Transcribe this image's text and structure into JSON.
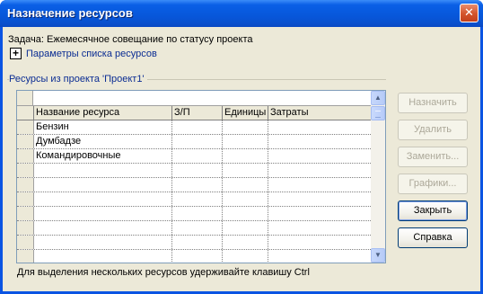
{
  "window": {
    "title": "Назначение ресурсов",
    "close_glyph": "✕"
  },
  "task": {
    "text": "Задача: Ежемесячное совещание по статусу проекта"
  },
  "options": {
    "expander_glyph": "+",
    "label": "Параметры списка ресурсов"
  },
  "group": {
    "title": "Ресурсы из проекта 'Проект1'"
  },
  "grid": {
    "edit_value": "",
    "columns": [
      "Название ресурса",
      "З/П",
      "Единицы",
      "Затраты"
    ],
    "rows": [
      {
        "name": "Бензин",
        "rate": "",
        "units": "",
        "cost": ""
      },
      {
        "name": "Думбадзе",
        "rate": "",
        "units": "",
        "cost": ""
      },
      {
        "name": "Командировочные",
        "rate": "",
        "units": "",
        "cost": ""
      },
      {
        "name": "",
        "rate": "",
        "units": "",
        "cost": ""
      },
      {
        "name": "",
        "rate": "",
        "units": "",
        "cost": ""
      },
      {
        "name": "",
        "rate": "",
        "units": "",
        "cost": ""
      },
      {
        "name": "",
        "rate": "",
        "units": "",
        "cost": ""
      },
      {
        "name": "",
        "rate": "",
        "units": "",
        "cost": ""
      },
      {
        "name": "",
        "rate": "",
        "units": "",
        "cost": ""
      },
      {
        "name": "",
        "rate": "",
        "units": "",
        "cost": ""
      }
    ],
    "scroll_up_glyph": "▲",
    "scroll_down_glyph": "▼"
  },
  "buttons": {
    "assign": "Назначить",
    "remove": "Удалить",
    "replace": "Заменить...",
    "graphs": "Графики...",
    "close": "Закрыть",
    "help": "Справка"
  },
  "footer": {
    "hint": "Для выделения нескольких ресурсов удерживайте клавишу Ctrl"
  },
  "colors": {
    "title_bar": "#0a5fe6",
    "dialog_bg": "#ece9d8",
    "link_blue": "#0b2d93",
    "close_red": "#d3542b"
  }
}
